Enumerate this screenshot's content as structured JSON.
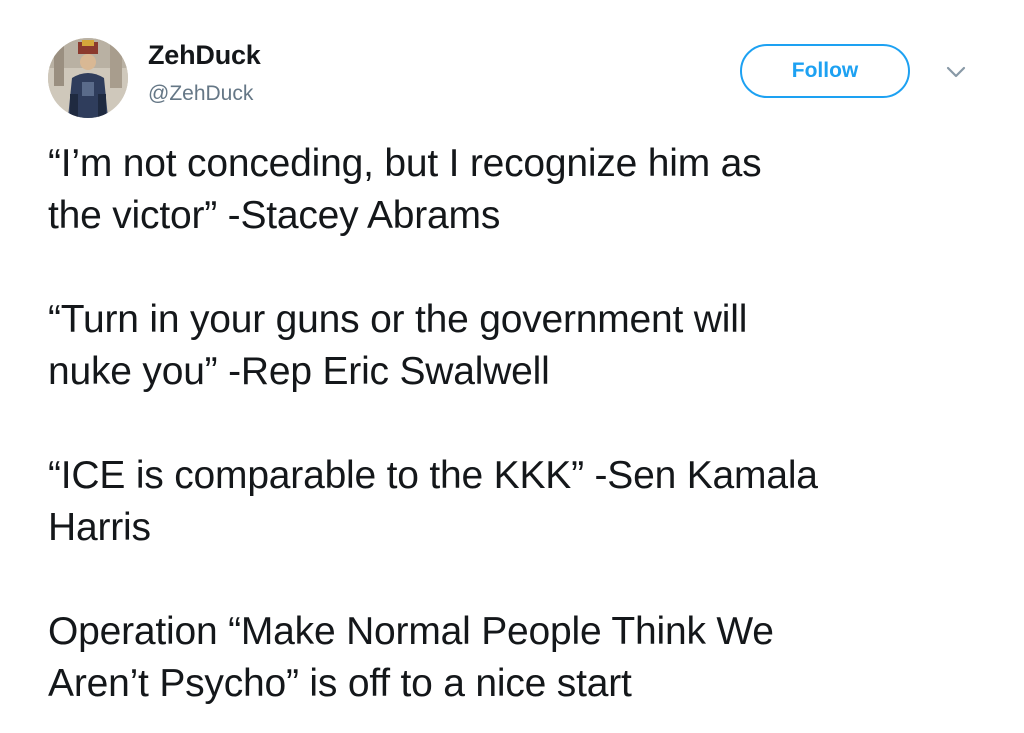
{
  "tweet": {
    "author": {
      "name": "ZehDuck",
      "handle": "@ZehDuck"
    },
    "follow_label": "Follow",
    "paragraphs": [
      "“I’m not conceding, but I recognize him as\nthe victor” -Stacey Abrams",
      "“Turn in your guns or the government will\nnuke you” -Rep Eric Swalwell",
      "“ICE is comparable to the KKK” -Sen Kamala\nHarris",
      "Operation “Make Normal People Think We\nAren’t Psycho” is off to a nice start"
    ]
  },
  "icons": {
    "avatar": "profile-photo",
    "menu": "chevron-down-icon"
  },
  "colors": {
    "accent": "#1da1f2",
    "text": "#14171a",
    "secondary_text": "#657786",
    "caret": "#8899a6"
  }
}
